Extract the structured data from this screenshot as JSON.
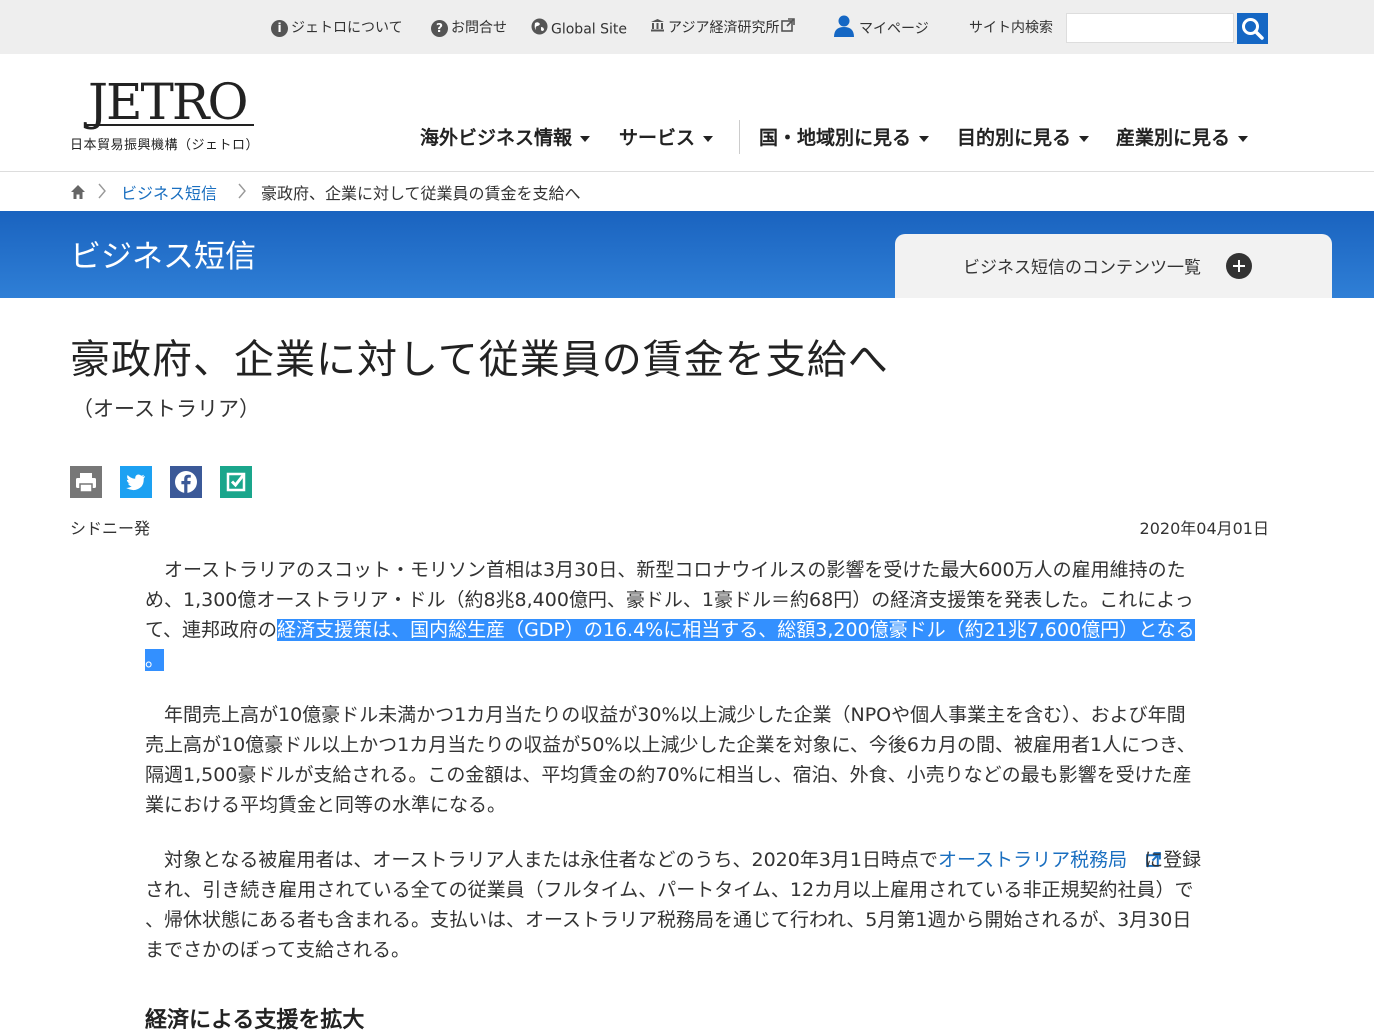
{
  "utility": {
    "about": "ジェトロについて",
    "contact": "お問合せ",
    "global": "Global Site",
    "ide": "アジア経済研究所",
    "mypage": "マイページ",
    "search_label": "サイト内検索",
    "search_placeholder": ""
  },
  "logo": {
    "mark": "JETRO",
    "sub": "日本貿易振興機構（ジェトロ）"
  },
  "nav": [
    {
      "label": "海外ビジネス情報"
    },
    {
      "label": "サービス"
    },
    {
      "label": "国・地域別に見る"
    },
    {
      "label": "目的別に見る"
    },
    {
      "label": "産業別に見る"
    }
  ],
  "breadcrumb": {
    "section": "ビジネス短信",
    "current": "豪政府、企業に対して従業員の賃金を支給へ"
  },
  "banner": {
    "title": "ビジネス短信",
    "contents_tab": "ビジネス短信のコンテンツ一覧"
  },
  "article": {
    "title": "豪政府、企業に対して従業員の賃金を支給へ",
    "country": "（オーストラリア）",
    "dateline": "シドニー発",
    "date": "2020年04月01日",
    "p1_a": "オーストラリアのスコット・モリソン首相は3月30日、新型コロナウイルスの影響を受けた最大600万人の雇用維持のため、1,300億オーストラリア・ドル（約8兆8,400億円、豪ドル、1豪ドル＝約68円）の経済支援策を発表した。これによって、連邦政府の",
    "p1_hl": "経済支援策は、国内総生産（GDP）の16.4%に相当する、総額3,200億豪ドル（約21兆7,600億円）となる。",
    "p2": "年間売上高が10億豪ドル未満かつ1カ月当たりの収益が30%以上減少した企業（NPOや個人事業主を含む）、および年間売上高が10億豪ドル以上かつ1カ月当たりの収益が50%以上減少した企業を対象に、今後6カ月の間、被雇用者1人につき、隔週1,500豪ドルが支給される。この金額は、平均賃金の約70%に相当し、宿泊、外食、小売りなどの最も影響を受けた産業における平均賃金と同等の水準になる。",
    "p3_a": "対象となる被雇用者は、オーストラリア人または永住者などのうち、2020年3月1日時点で",
    "p3_link": "オーストラリア税務局",
    "p3_b": "に登録され、引き続き雇用されている全ての従業員（フルタイム、パートタイム、12カ月以上雇用されている非正規契約社員）で、帰休状態にある者も含まれる。支払いは、オーストラリア税務局を通じて行われ、5月第1週から開始されるが、3月30日までさかのぼって支給される。",
    "next_heading": "経済による支援を拡大"
  },
  "colors": {
    "brand_blue": "#1a63bf",
    "link": "#1a6fc0",
    "twitter": "#1da1f2",
    "facebook": "#3b5998",
    "check": "#1aa68c",
    "print": "#777777"
  }
}
